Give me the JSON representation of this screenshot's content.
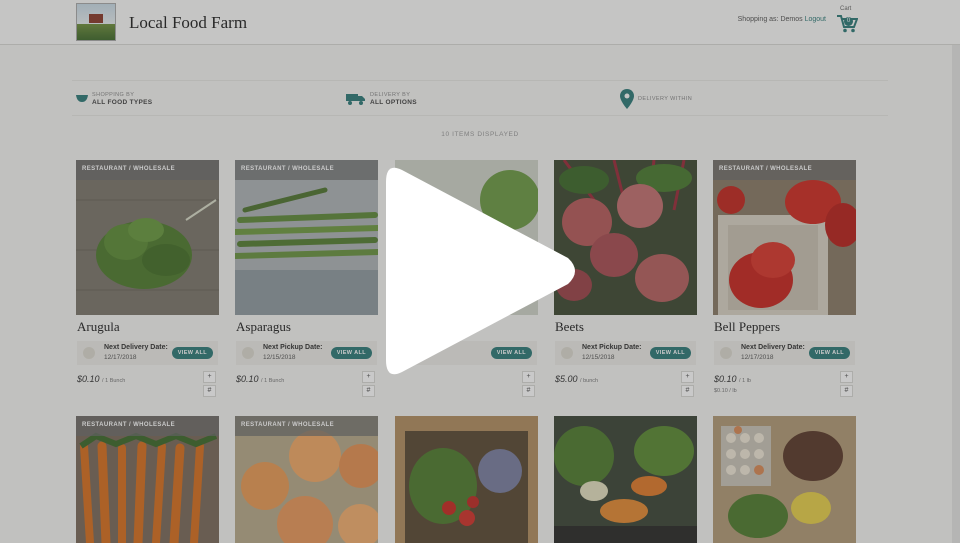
{
  "header": {
    "brand": "Local Food Farm",
    "shopping_as_prefix": "Shopping as: Demos",
    "logout": "Logout",
    "cart_label": "Cart",
    "cart_count": "0"
  },
  "filters": [
    {
      "top": "SHOPPING BY",
      "bottom": "ALL FOOD TYPES"
    },
    {
      "top": "DELIVERY BY",
      "bottom": "ALL OPTIONS"
    },
    {
      "top": "DELIVERY WITHIN",
      "bottom": ""
    }
  ],
  "items_count": "10 ITEMS DISPLAYED",
  "products": [
    {
      "tag": "RESTAURANT / WHOLESALE",
      "name": "Arugula",
      "delivery_label": "Next Delivery Date:",
      "delivery_date": "12/17/2018",
      "view_all": "VIEW ALL",
      "price": "$0.10",
      "unit": "/ 1 Bunch",
      "subprice": ""
    },
    {
      "tag": "RESTAURANT / WHOLESALE",
      "name": "Asparagus",
      "delivery_label": "Next Pickup Date:",
      "delivery_date": "12/15/2018",
      "view_all": "VIEW ALL",
      "price": "$0.10",
      "unit": "/ 1 Bunch",
      "subprice": ""
    },
    {
      "tag": "",
      "name": "",
      "delivery_label": "",
      "delivery_date": "",
      "view_all": "VIEW ALL",
      "price": "",
      "unit": "",
      "subprice": ""
    },
    {
      "tag": "",
      "name": "Beets",
      "delivery_label": "Next Pickup Date:",
      "delivery_date": "12/15/2018",
      "view_all": "VIEW ALL",
      "price": "$5.00",
      "unit": "/ bunch",
      "subprice": ""
    },
    {
      "tag": "RESTAURANT / WHOLESALE",
      "name": "Bell Peppers",
      "delivery_label": "Next Delivery Date:",
      "delivery_date": "12/17/2018",
      "view_all": "VIEW ALL",
      "price": "$0.10",
      "unit": "/ 1 lb",
      "subprice": "$0.10 / lb"
    },
    {
      "tag": "RESTAURANT / WHOLESALE"
    },
    {
      "tag": "RESTAURANT / WHOLESALE"
    },
    {
      "tag": ""
    },
    {
      "tag": ""
    },
    {
      "tag": ""
    }
  ],
  "stepper": {
    "plus": "+",
    "hash": "#"
  },
  "colors": {
    "accent": "#2e7a78",
    "overlay": "#3c3c3c"
  },
  "icons": {
    "play": "play-icon",
    "cart": "cart-icon",
    "bowl": "bowl-icon",
    "truck": "truck-icon",
    "pin": "map-pin-icon"
  }
}
